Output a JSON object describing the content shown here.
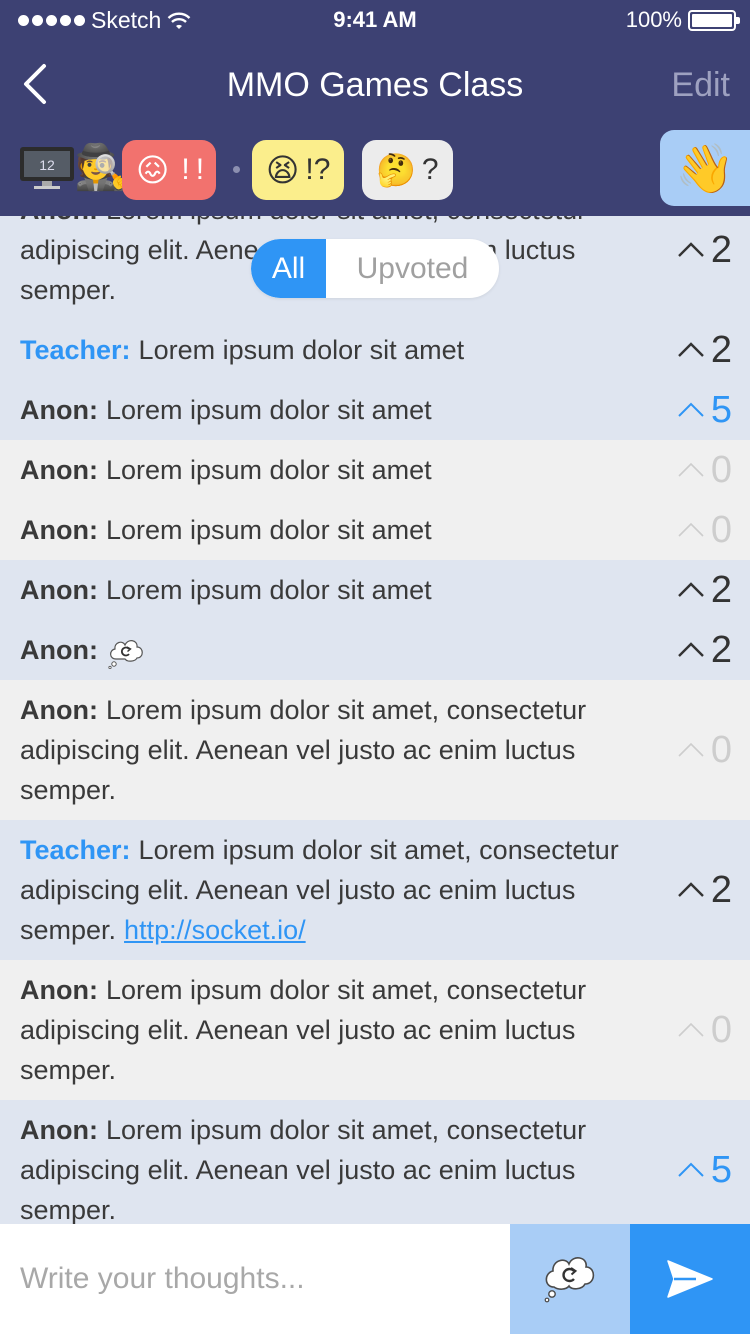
{
  "status_bar": {
    "carrier": "Sketch",
    "time": "9:41 AM",
    "battery": "100%"
  },
  "nav": {
    "title": "MMO Games Class",
    "edit_label": "Edit"
  },
  "reactions": {
    "monitor_number": "12",
    "confused": {
      "emoji": "😖",
      "marks": "!!"
    },
    "frustrated": {
      "emoji": "😫",
      "marks": "!?"
    },
    "thinking": {
      "emoji": "🤔",
      "marks": "?"
    },
    "wave": "👋"
  },
  "filter": {
    "all_label": "All",
    "upvoted_label": "Upvoted",
    "selected": "All"
  },
  "messages": [
    {
      "author": "Anon:",
      "text": "Lorem ipsum dolor sit amet, consectetur adipiscing elit. Aenean vel justo ac enim luctus semper.",
      "votes": "2"
    },
    {
      "author": "Teacher:",
      "text": "Lorem ipsum dolor sit amet",
      "votes": "2"
    },
    {
      "author": "Anon:",
      "text": "Lorem ipsum dolor sit amet",
      "votes": "5"
    },
    {
      "author": "Anon:",
      "text": "Lorem ipsum dolor sit amet",
      "votes": "0"
    },
    {
      "author": "Anon:",
      "text": "Lorem ipsum dolor sit amet",
      "votes": "0"
    },
    {
      "author": "Anon:",
      "text": "Lorem ipsum dolor sit amet",
      "votes": "2"
    },
    {
      "author": "Anon:",
      "votes": "2"
    },
    {
      "author": "Anon:",
      "text": "Lorem ipsum dolor sit amet, consectetur adipiscing elit. Aenean vel justo ac enim luctus semper.",
      "votes": "0"
    },
    {
      "author": "Teacher:",
      "text": "Lorem ipsum dolor sit amet, consectetur adipiscing elit. Aenean vel justo ac enim luctus semper.",
      "link": "http://socket.io/",
      "votes": "2"
    },
    {
      "author": "Anon:",
      "text": "Lorem ipsum dolor sit amet, consectetur adipiscing elit. Aenean vel justo ac enim luctus semper.",
      "votes": "0"
    },
    {
      "author": "Anon:",
      "text": "Lorem ipsum dolor sit amet, consectetur adipiscing elit. Aenean vel justo ac enim luctus semper.",
      "votes": "5"
    }
  ],
  "composer": {
    "placeholder": "Write your thoughts..."
  },
  "colors": {
    "header": "#3d4173",
    "accent": "#2f95f5",
    "highlight_row": "#dfe5f0",
    "plain_row": "#f0f0f0"
  }
}
